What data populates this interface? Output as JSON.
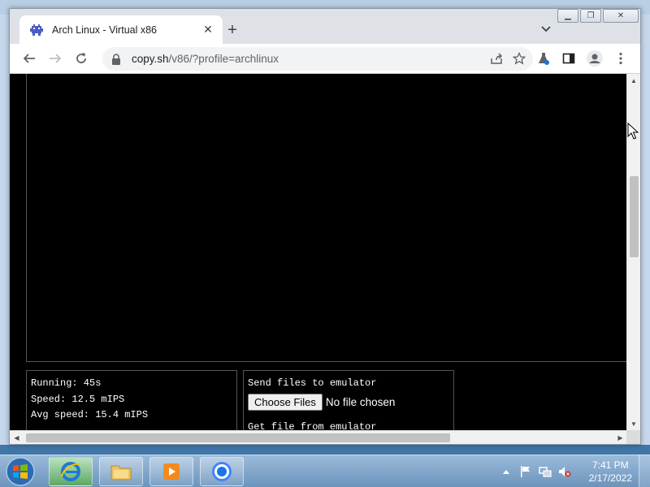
{
  "browser": {
    "tab": {
      "title": "Arch Linux - Virtual x86",
      "favicon": "arch-invader-icon"
    },
    "new_tab_icon": "plus-icon",
    "tab_search_icon": "chevron-down-icon",
    "url": {
      "host": "copy.sh",
      "path": "/v86/?profile=archlinux"
    },
    "toolbar_icons": [
      "back-icon",
      "forward-icon",
      "reload-icon",
      "lock-icon",
      "share-icon",
      "star-icon",
      "extension-flask-icon",
      "side-panel-icon",
      "profile-icon",
      "menu-dots-icon"
    ],
    "window_controls": [
      "minimize",
      "restore",
      "close"
    ]
  },
  "emulator": {
    "stats": {
      "running": "Running: 45s",
      "speed": "Speed: 12.5 mIPS",
      "avg_speed": "Avg speed: 15.4 mIPS"
    },
    "files": {
      "send_heading": "Send files to emulator",
      "choose_button": "Choose Files",
      "no_file": "No file chosen",
      "get_heading": "Get file from emulator"
    }
  },
  "taskbar": {
    "items": [
      "internet-explorer-icon",
      "file-explorer-icon",
      "media-player-icon",
      "chrome-icon"
    ],
    "clock": {
      "time": "7:41 PM",
      "date": "2/17/2022"
    }
  },
  "colors": {
    "chrome_frame": "#dee1e6",
    "content_bg": "#000000",
    "accent_arch": "#1793d1"
  }
}
